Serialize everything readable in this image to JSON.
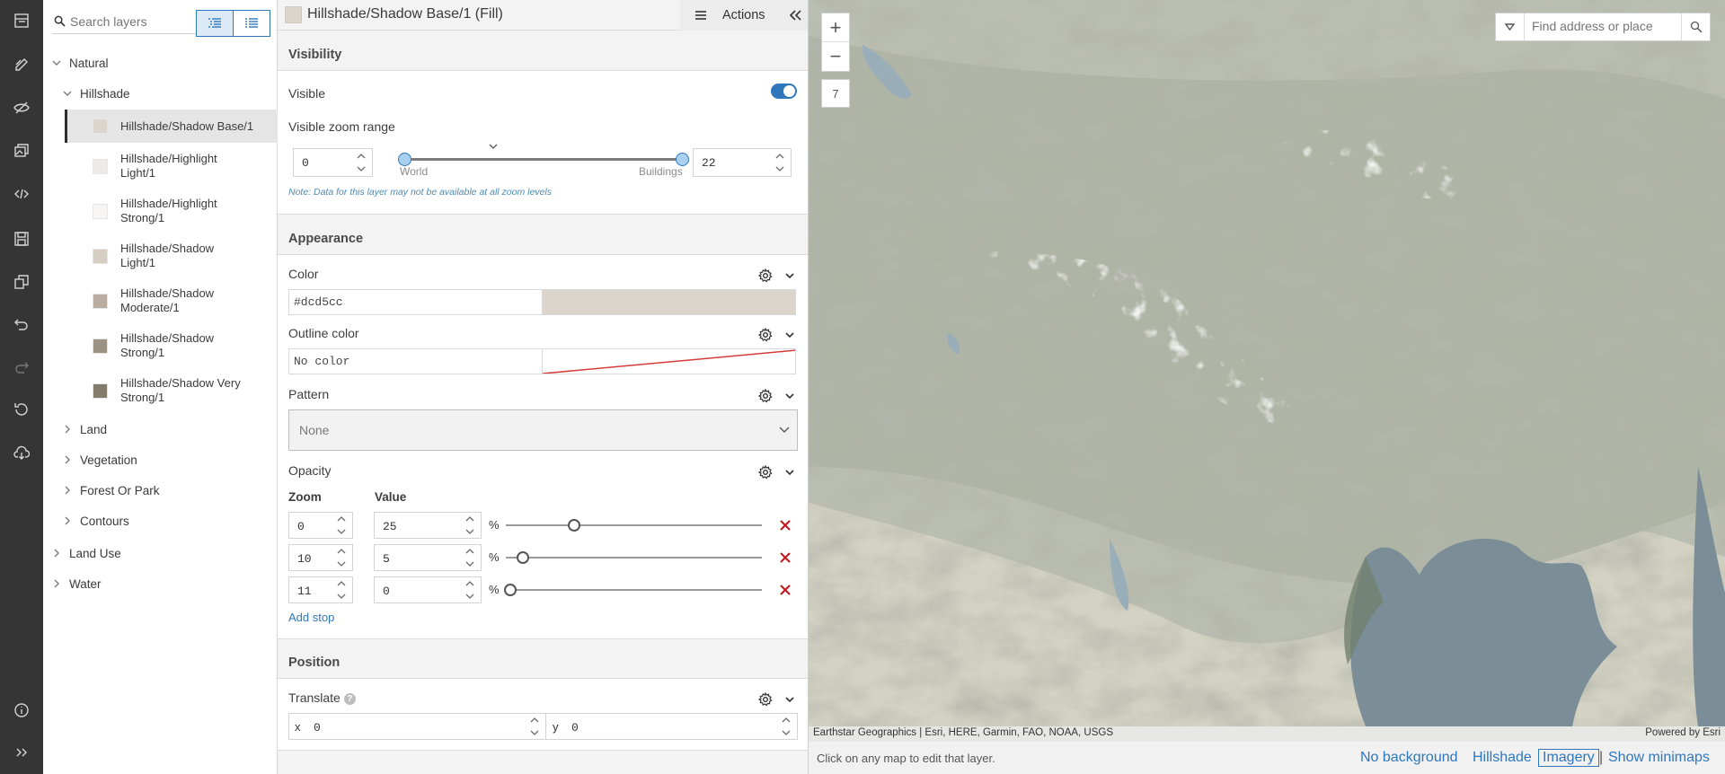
{
  "layers": {
    "search_placeholder": "Search layers",
    "tree": {
      "natural": "Natural",
      "hillshade": "Hillshade",
      "items": [
        {
          "line1": "Hillshade/Shadow Base/1",
          "line2": "",
          "color": "#dcd5cc"
        },
        {
          "line1": "Hillshade/Highlight",
          "line2": "Light/1",
          "color": "#ecebe7"
        },
        {
          "line1": "Hillshade/Highlight",
          "line2": "Strong/1",
          "color": "#f8f6f4"
        },
        {
          "line1": "Hillshade/Shadow",
          "line2": "Light/1",
          "color": "#d6cdc3"
        },
        {
          "line1": "Hillshade/Shadow",
          "line2": "Moderate/1",
          "color": "#b9ada1"
        },
        {
          "line1": "Hillshade/Shadow",
          "line2": "Strong/1",
          "color": "#9d9385"
        },
        {
          "line1": "Hillshade/Shadow Very",
          "line2": "Strong/1",
          "color": "#857b6c"
        }
      ],
      "land": "Land",
      "vegetation": "Vegetation",
      "forest": "Forest Or Park",
      "contours": "Contours",
      "land_use": "Land Use",
      "water": "Water"
    }
  },
  "editor": {
    "title": "Hillshade/Shadow Base/1 (Fill)",
    "actions_label": "Actions",
    "visibility": {
      "heading": "Visibility",
      "visible_label": "Visible",
      "zoom_range_label": "Visible zoom range",
      "min_zoom": "0",
      "max_zoom": "22",
      "world_label": "World",
      "buildings_label": "Buildings",
      "note": "Note: Data for this layer may not be available at all zoom levels"
    },
    "appearance": {
      "heading": "Appearance",
      "color_label": "Color",
      "color_value": "#dcd5cc",
      "outline_label": "Outline color",
      "outline_value": "No color",
      "pattern_label": "Pattern",
      "pattern_value": "None",
      "opacity_label": "Opacity",
      "zoom_col": "Zoom",
      "value_col": "Value",
      "stops": [
        {
          "zoom": "0",
          "value": "25",
          "pct": 25
        },
        {
          "zoom": "10",
          "value": "5",
          "pct": 5
        },
        {
          "zoom": "11",
          "value": "0",
          "pct": 0
        }
      ],
      "pct_symbol": "%",
      "add_stop": "Add stop"
    },
    "position": {
      "heading": "Position",
      "translate_label": "Translate",
      "help": "?",
      "x_label": "x",
      "x_value": "0",
      "y_label": "y",
      "y_value": "0"
    }
  },
  "map": {
    "zoom_level": "7",
    "search_placeholder": "Find address or place",
    "attribution": "Earthstar Geographics | Esri, HERE, Garmin, FAO, NOAA, USGS",
    "powered_by": "Powered by Esri",
    "footer_hint": "Click on any map to edit that layer.",
    "footer_options": {
      "no_background": "No background",
      "hillshade": "Hillshade",
      "imagery": "Imagery",
      "separator": "|",
      "show_minimaps": "Show minimaps"
    }
  }
}
